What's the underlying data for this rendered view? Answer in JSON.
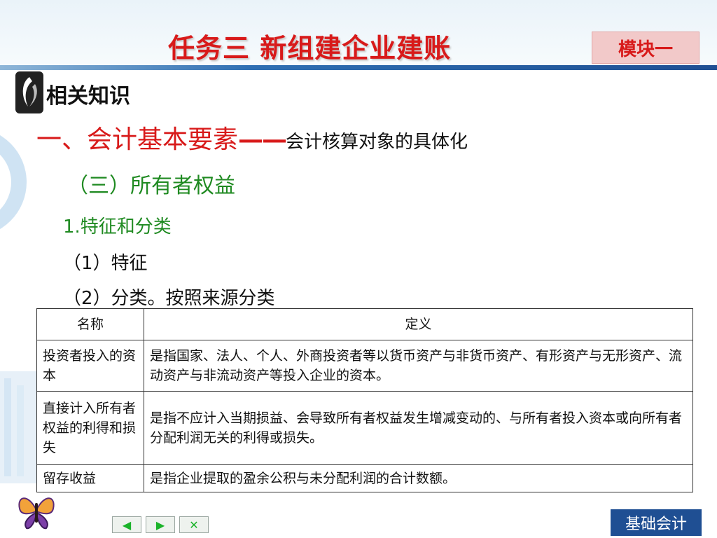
{
  "slide": {
    "title": "任务三 新组建企业建账",
    "module_badge": "模块一",
    "knowledge_label": "相关知识",
    "section_main": "一、会计基本要素",
    "section_dash": "——",
    "section_sub": "会计核算对象的具体化",
    "subsection": "（三）所有者权益",
    "point1": "1.特征和分类",
    "point2": "（1）特征",
    "point3": "（2）分类。按照来源分类",
    "footer_badge": "基础会计"
  },
  "table": {
    "headers": [
      "名称",
      "定义"
    ],
    "rows": [
      {
        "name": "投资者投入的资本",
        "definition": "是指国家、法人、个人、外商投资者等以货币资产与非货币资产、有形资产与无形资产、流动资产与非流动资产等投入企业的资本。"
      },
      {
        "name": "直接计入所有者权益的利得和损失",
        "definition": "是指不应计入当期损益、会导致所有者权益发生增减变动的、与所有者投入资本或向所有者分配利润无关的利得或损失。"
      },
      {
        "name": "留存收益",
        "definition": "是指企业提取的盈余公积与未分配利润的合计数额。"
      }
    ]
  },
  "nav": {
    "prev_icon": "◀",
    "next_icon": "▶",
    "close_icon": "✕"
  },
  "colors": {
    "title_red": "#d81a1a",
    "green": "#1f8a21",
    "blue": "#1f4f93"
  }
}
